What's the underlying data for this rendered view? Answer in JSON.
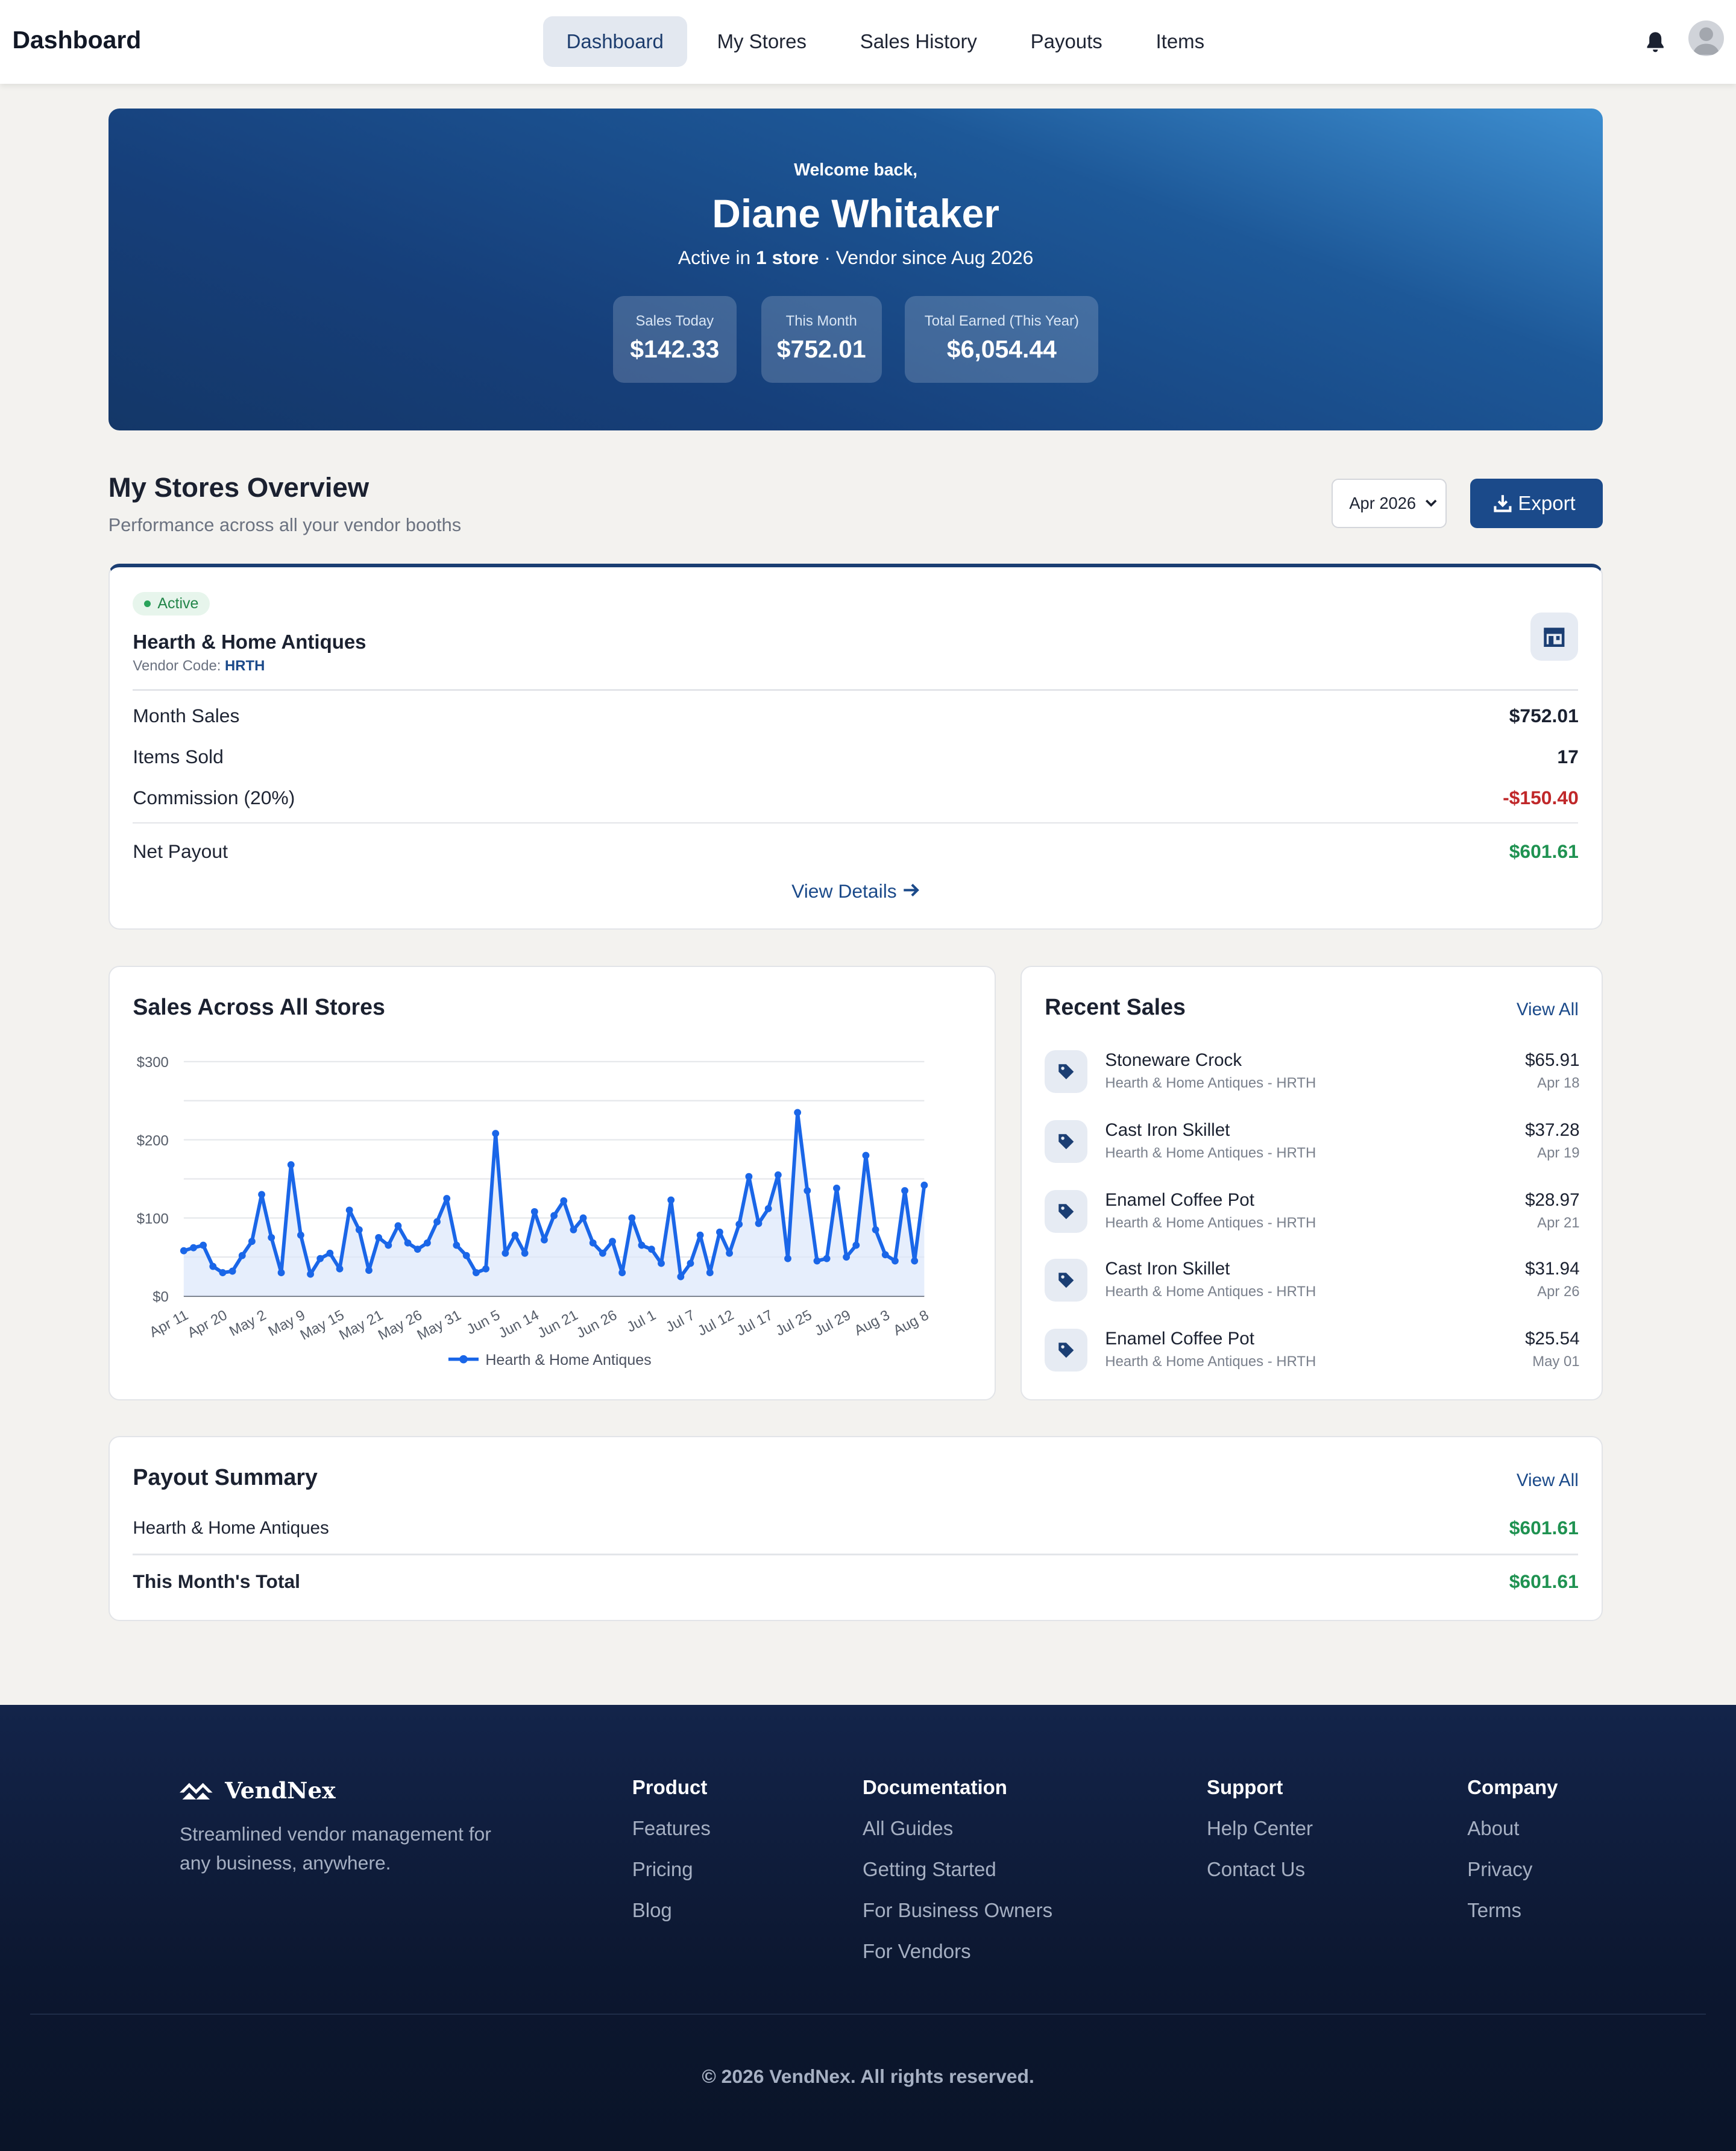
{
  "header": {
    "title": "Dashboard",
    "nav": [
      "Dashboard",
      "My Stores",
      "Sales History",
      "Payouts",
      "Items"
    ],
    "active_tab": "Dashboard"
  },
  "hero": {
    "welcome": "Welcome back,",
    "name": "Diane Whitaker",
    "active_prefix": "Active in ",
    "active_stores": "1 store",
    "vendor_since": " · Vendor since Aug 2026",
    "stats": [
      {
        "label": "Sales Today",
        "value": "$142.33"
      },
      {
        "label": "This Month",
        "value": "$752.01"
      },
      {
        "label": "Total Earned (This Year)",
        "value": "$6,054.44"
      }
    ]
  },
  "overview": {
    "title": "My Stores Overview",
    "subtitle": "Performance across all your vendor booths",
    "month_select": "Apr 2026",
    "export_label": "Export"
  },
  "store": {
    "status": "Active",
    "name": "Hearth & Home Antiques",
    "vendor_code_label": "Vendor Code: ",
    "vendor_code": "HRTH",
    "rows": [
      {
        "label": "Month Sales",
        "value": "$752.01"
      },
      {
        "label": "Items Sold",
        "value": "17"
      },
      {
        "label": "Commission (20%)",
        "value": "-$150.40"
      },
      {
        "label": "Net Payout",
        "value": "$601.61"
      }
    ],
    "view_details": "View Details"
  },
  "chart_card": {
    "title": "Sales Across All Stores"
  },
  "chart_data": {
    "type": "line",
    "title": "",
    "xlabel": "",
    "ylabel": "",
    "ylim": [
      0,
      300
    ],
    "y_ticks": [
      "$0",
      "$100",
      "$200",
      "$300"
    ],
    "x_tick_labels": [
      "Apr 11",
      "Apr 20",
      "May 2",
      "May 9",
      "May 15",
      "May 21",
      "May 26",
      "May 31",
      "Jun 5",
      "Jun 14",
      "Jun 21",
      "Jun 26",
      "Jul 1",
      "Jul 7",
      "Jul 12",
      "Jul 17",
      "Jul 25",
      "Jul 29",
      "Aug 3",
      "Aug 8"
    ],
    "legend_position": "bottom",
    "series": [
      {
        "name": "Hearth & Home Antiques",
        "color": "#1a66e8",
        "values": [
          58,
          62,
          65,
          38,
          30,
          32,
          52,
          70,
          130,
          75,
          30,
          168,
          78,
          28,
          48,
          55,
          35,
          110,
          85,
          33,
          75,
          65,
          90,
          68,
          60,
          68,
          95,
          125,
          65,
          52,
          30,
          35,
          208,
          55,
          78,
          55,
          108,
          72,
          103,
          122,
          85,
          100,
          68,
          55,
          70,
          30,
          100,
          65,
          60,
          42,
          123,
          25,
          42,
          78,
          30,
          82,
          55,
          92,
          153,
          93,
          112,
          155,
          48,
          235,
          135,
          45,
          48,
          138,
          50,
          65,
          180,
          85,
          53,
          45,
          135,
          45,
          142
        ]
      }
    ]
  },
  "recent_sales": {
    "title": "Recent Sales",
    "view_all": "View All",
    "items": [
      {
        "name": "Stoneware Crock",
        "store": "Hearth & Home Antiques - HRTH",
        "amount": "$65.91",
        "date": "Apr 18"
      },
      {
        "name": "Cast Iron Skillet",
        "store": "Hearth & Home Antiques - HRTH",
        "amount": "$37.28",
        "date": "Apr 19"
      },
      {
        "name": "Enamel Coffee Pot",
        "store": "Hearth & Home Antiques - HRTH",
        "amount": "$28.97",
        "date": "Apr 21"
      },
      {
        "name": "Cast Iron Skillet",
        "store": "Hearth & Home Antiques - HRTH",
        "amount": "$31.94",
        "date": "Apr 26"
      },
      {
        "name": "Enamel Coffee Pot",
        "store": "Hearth & Home Antiques - HRTH",
        "amount": "$25.54",
        "date": "May 01"
      }
    ]
  },
  "payout": {
    "title": "Payout Summary",
    "view_all": "View All",
    "store_label": "Hearth & Home Antiques",
    "store_value": "$601.61",
    "total_label": "This Month's Total",
    "total_value": "$601.61"
  },
  "footer": {
    "brand": "VendNex",
    "tagline": "Streamlined vendor management for any business, anywhere.",
    "columns": [
      {
        "heading": "Product",
        "links": [
          "Features",
          "Pricing",
          "Blog"
        ]
      },
      {
        "heading": "Documentation",
        "links": [
          "All Guides",
          "Getting Started",
          "For Business Owners",
          "For Vendors"
        ]
      },
      {
        "heading": "Support",
        "links": [
          "Help Center",
          "Contact Us"
        ]
      },
      {
        "heading": "Company",
        "links": [
          "About",
          "Privacy",
          "Terms"
        ]
      }
    ],
    "copyright": "© 2026 VendNex. All rights reserved."
  },
  "colors": {
    "primary": "#1b4a8a",
    "positive": "#1f9251",
    "negative": "#c0282a",
    "chart_line": "#1a66e8"
  }
}
